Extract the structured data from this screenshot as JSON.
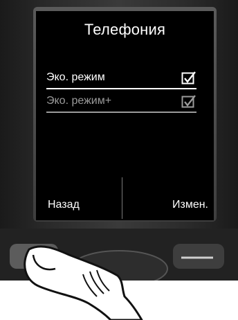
{
  "screen": {
    "title": "Телефония",
    "items": [
      {
        "label": "Эко. режим",
        "checked": true,
        "enabled": true
      },
      {
        "label": "Эко. режим+",
        "checked": true,
        "enabled": false
      }
    ]
  },
  "softkeys": {
    "left_label": "Назад",
    "right_label": "Измен."
  },
  "colors": {
    "screen_bg": "#000000",
    "text": "#ffffff",
    "disabled_text": "#9b9b9b"
  },
  "icons": {
    "checkbox": "checkbox-checked-icon",
    "hand": "finger-pressing-icon"
  }
}
